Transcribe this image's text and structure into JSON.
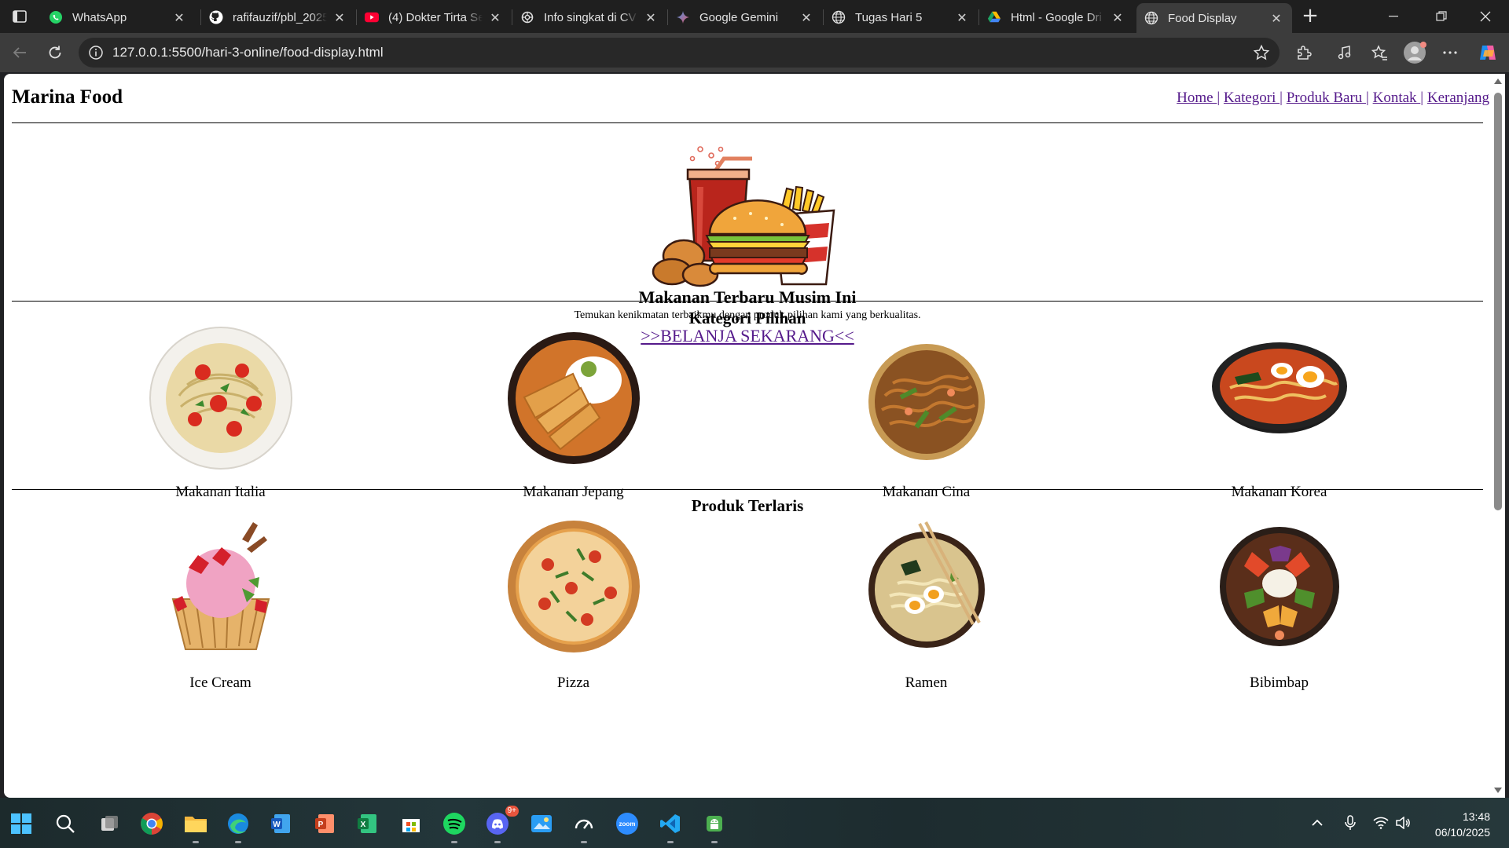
{
  "browser": {
    "tabs": [
      {
        "title": "WhatsApp",
        "icon": "whatsapp-icon",
        "active": false
      },
      {
        "title": "rafifauzif/pbl_2025",
        "icon": "github-icon",
        "active": false
      },
      {
        "title": "(4) Dokter Tirta Se",
        "icon": "youtube-icon",
        "active": false
      },
      {
        "title": "Info singkat di CV",
        "icon": "chatgpt-icon",
        "active": false
      },
      {
        "title": "Google Gemini",
        "icon": "gemini-icon",
        "active": false
      },
      {
        "title": "Tugas Hari 5",
        "icon": "globe-icon",
        "active": false
      },
      {
        "title": "Html - Google Dri",
        "icon": "google-drive-icon",
        "active": false
      },
      {
        "title": "Food Display",
        "icon": "globe-icon",
        "active": true
      }
    ],
    "url": "127.0.0.1:5500/hari-3-online/food-display.html"
  },
  "page": {
    "site_title": "Marina Food",
    "nav": [
      {
        "label": "Home "
      },
      {
        "label": "Kategori "
      },
      {
        "label": "Produk Baru "
      },
      {
        "label": "Kontak "
      },
      {
        "label": "Keranjang"
      }
    ],
    "nav_separator": "|",
    "hero": {
      "image_icon": "fast-food-illustration",
      "title": "Makanan Terbaru Musim Ini",
      "subtitle": "Temukan kenikmatan terbaikmu dengan produk pilihan kami yang berkualitas.",
      "cta": ">>BELANJA SEKARANG<<"
    },
    "categories": {
      "title": "Kategori Pilihan",
      "items": [
        {
          "label": "Makanan Italia",
          "icon": "spaghetti-image"
        },
        {
          "label": "Makanan Jepang",
          "icon": "katsu-curry-image"
        },
        {
          "label": "Makanan Cina",
          "icon": "noodles-image"
        },
        {
          "label": "Makanan Korea",
          "icon": "ramyeon-image"
        }
      ]
    },
    "bestsellers": {
      "title": "Produk Terlaris",
      "items": [
        {
          "label": "Ice Cream",
          "icon": "ice-cream-image"
        },
        {
          "label": "Pizza",
          "icon": "pizza-image"
        },
        {
          "label": "Ramen",
          "icon": "ramen-image"
        },
        {
          "label": "Bibimbap",
          "icon": "bibimbap-image"
        }
      ]
    },
    "link_color": "#551a8b"
  },
  "taskbar": {
    "apps": [
      "windows-start-icon",
      "search-icon",
      "task-view-icon",
      "chrome-icon",
      "file-explorer-icon",
      "edge-icon",
      "word-icon",
      "powerpoint-icon",
      "excel-icon",
      "microsoft-store-icon",
      "spotify-icon",
      "discord-icon",
      "photos-icon",
      "speedtest-icon",
      "zoom-icon",
      "vscode-icon",
      "android-icon"
    ],
    "discord_badge": "9+",
    "zoom_label": "zoom",
    "time": "13:48",
    "date": "06/10/2025"
  }
}
